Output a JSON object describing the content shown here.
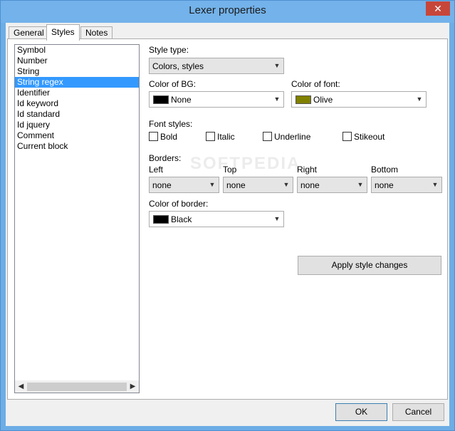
{
  "window": {
    "title": "Lexer properties",
    "close_glyph": "✕"
  },
  "tabs": [
    {
      "label": "General",
      "active": false
    },
    {
      "label": "Styles",
      "active": true
    },
    {
      "label": "Notes",
      "active": false
    }
  ],
  "style_list": {
    "items": [
      "Symbol",
      "Number",
      "String",
      "String regex",
      "Identifier",
      "Id keyword",
      "Id standard",
      "Id jquery",
      "Comment",
      "Current block"
    ],
    "selected": "String regex"
  },
  "style_type": {
    "label": "Style type:",
    "value": "Colors, styles"
  },
  "color_bg": {
    "label": "Color of BG:",
    "value": "None",
    "swatch": "#000000"
  },
  "color_font": {
    "label": "Color of font:",
    "value": "Olive",
    "swatch": "#808000"
  },
  "font_styles": {
    "label": "Font styles:",
    "bold": "Bold",
    "italic": "Italic",
    "underline": "Underline",
    "strikeout": "Stikeout"
  },
  "borders": {
    "label": "Borders:",
    "left_label": "Left",
    "left_value": "none",
    "top_label": "Top",
    "top_value": "none",
    "right_label": "Right",
    "right_value": "none",
    "bottom_label": "Bottom",
    "bottom_value": "none"
  },
  "color_border": {
    "label": "Color of border:",
    "value": "Black",
    "swatch": "#000000"
  },
  "buttons": {
    "apply": "Apply style changes",
    "ok": "OK",
    "cancel": "Cancel"
  },
  "watermark": "SOFTPEDIA"
}
